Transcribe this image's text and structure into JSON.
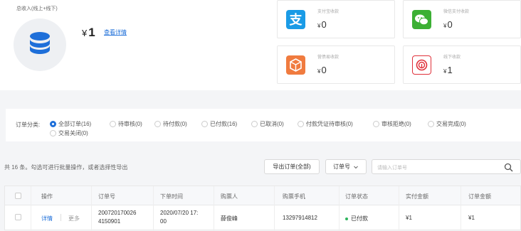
{
  "summary": {
    "total_label": "总收入(线上+线下)",
    "currency": "¥",
    "total_value": "1",
    "detail_link": "查看详情"
  },
  "cards": [
    {
      "label": "支付宝收款",
      "currency": "¥",
      "value": "0",
      "icon": "alipay-icon",
      "color": "#1a9be6"
    },
    {
      "label": "微信支付收款",
      "currency": "¥",
      "value": "0",
      "icon": "wechat-icon",
      "color": "#3cb034"
    },
    {
      "label": "营债易收款",
      "currency": "¥",
      "value": "0",
      "icon": "box-icon",
      "color": "#f07b3f"
    },
    {
      "label": "线下收款",
      "currency": "¥",
      "value": "1",
      "icon": "fingerprint-icon",
      "color": "#e0313a"
    }
  ],
  "filter": {
    "label": "订单分类:",
    "options": [
      {
        "label": "全部订单(16)",
        "selected": true
      },
      {
        "label": "待审核(0)",
        "selected": false
      },
      {
        "label": "待付款(0)",
        "selected": false
      },
      {
        "label": "已付款(16)",
        "selected": false
      },
      {
        "label": "已取消(0)",
        "selected": false
      },
      {
        "label": "付款凭证待审核(0)",
        "selected": false
      },
      {
        "label": "审核拒绝(0)",
        "selected": false
      },
      {
        "label": "交易完成(0)",
        "selected": false
      },
      {
        "label": "交易关闭(0)",
        "selected": false
      }
    ]
  },
  "toolbar": {
    "count_text": "共 16 条。勾选可进行批量操作，或者选择性导出",
    "export_button": "导出订单(全部)",
    "field_select": "订单号",
    "search_placeholder": "请输入订单号"
  },
  "table": {
    "headers": [
      "操作",
      "订单号",
      "下单时间",
      "购票人",
      "购票手机",
      "订单状态",
      "实付金额",
      "订单金额"
    ],
    "rows": [
      {
        "action_detail": "详情",
        "action_more": "更多",
        "order_no_1": "200720170026",
        "order_no_2": "4150901",
        "time_1": "2020/07/20 17:",
        "time_2": "00",
        "buyer": "薛俊峰",
        "phone": "13297914812",
        "status": "已付款",
        "paid": "¥1",
        "amount": "¥1"
      }
    ]
  },
  "colors": {
    "accent": "#1e6fd9",
    "status_paid": "#2db55d"
  }
}
